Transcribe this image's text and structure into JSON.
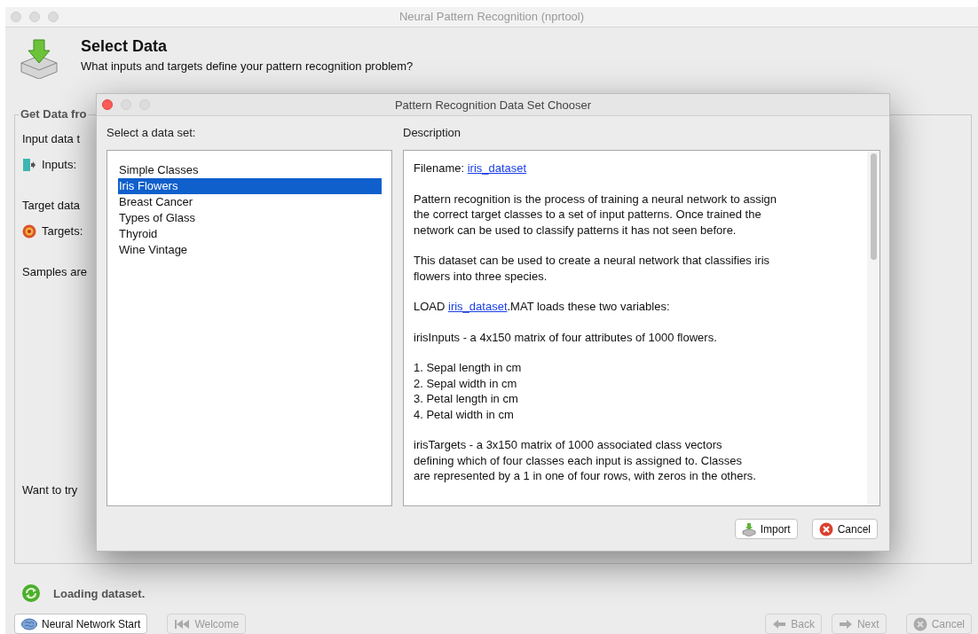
{
  "window": {
    "title": "Neural Pattern Recognition (nprtool)"
  },
  "header": {
    "title": "Select Data",
    "subtitle": "What inputs and targets define your pattern recognition problem?"
  },
  "panel": {
    "title": "Get Data fro",
    "labels": [
      {
        "kind": "text",
        "text": "Input data t"
      },
      {
        "kind": "inputs",
        "text": "Inputs:"
      },
      {
        "kind": "text",
        "text": "Target data"
      },
      {
        "kind": "targets",
        "text": "Targets:"
      },
      {
        "kind": "text",
        "text": "Samples are"
      },
      {
        "kind": "bottom",
        "text": "Want to try"
      }
    ]
  },
  "status": {
    "text": "Loading dataset."
  },
  "left_buttons": [
    {
      "label": "Neural Network Start",
      "kind": "start",
      "disabled": false
    },
    {
      "label": "Welcome",
      "kind": "welcome",
      "disabled": true
    }
  ],
  "right_buttons": [
    {
      "label": "Back",
      "kind": "back",
      "disabled": true
    },
    {
      "label": "Next",
      "kind": "next",
      "disabled": true
    },
    {
      "label": "Cancel",
      "kind": "cancel",
      "disabled": true
    }
  ],
  "dialog": {
    "title": "Pattern Recognition Data Set Chooser",
    "list_label": "Select a data set:",
    "datasets": [
      {
        "label": "Simple Classes",
        "selected": false
      },
      {
        "label": "Iris Flowers",
        "selected": true
      },
      {
        "label": "Breast Cancer",
        "selected": false
      },
      {
        "label": "Types of Glass",
        "selected": false
      },
      {
        "label": "Thyroid",
        "selected": false
      },
      {
        "label": "Wine Vintage",
        "selected": false
      }
    ],
    "description_label": "Description",
    "description": [
      {
        "kind": "segments",
        "segments": [
          {
            "text": "Filename: ",
            "kind": "text"
          },
          {
            "text": "iris_dataset",
            "kind": "link"
          }
        ]
      },
      {
        "kind": "lines",
        "lines": [
          "Pattern recognition is the process of training a neural network to assign",
          "the correct target classes to a set of input patterns. Once trained the",
          "network can be used to classify patterns it has not seen before."
        ]
      },
      {
        "kind": "lines",
        "lines": [
          "This dataset can be used to create a neural network that classifies iris",
          "flowers into three species."
        ]
      },
      {
        "kind": "segments",
        "segments": [
          {
            "text": "LOAD ",
            "kind": "text"
          },
          {
            "text": "iris_dataset",
            "kind": "link"
          },
          {
            "text": ".MAT loads these two variables:",
            "kind": "text"
          }
        ]
      },
      {
        "kind": "lines",
        "lines": [
          "irisInputs - a 4x150 matrix of four attributes of 1000 flowers."
        ]
      },
      {
        "kind": "lines",
        "lines": [
          "1. Sepal length in cm",
          "2. Sepal width in cm",
          "3. Petal length in cm",
          "4. Petal width in cm"
        ]
      },
      {
        "kind": "lines",
        "lines": [
          "irisTargets - a 3x150 matrix of 1000 associated class vectors",
          "defining which of four classes each input is assigned to. Classes",
          "are represented by a 1 in one of four rows, with zeros in the others."
        ]
      }
    ],
    "buttons": [
      {
        "label": "Import",
        "kind": "import"
      },
      {
        "label": "Cancel",
        "kind": "cancel"
      }
    ]
  }
}
